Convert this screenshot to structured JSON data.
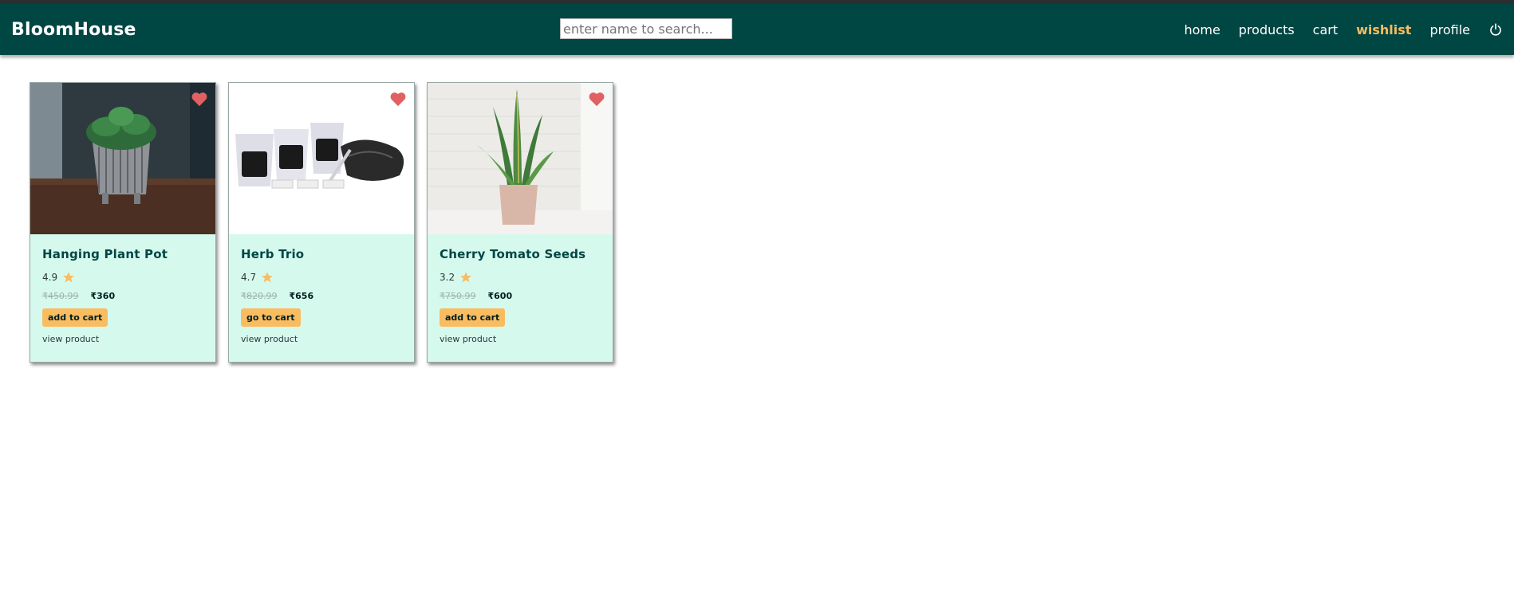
{
  "app": {
    "brand": "BloomHouse"
  },
  "search": {
    "placeholder": "enter name to search..."
  },
  "nav": {
    "links": [
      {
        "label": "home",
        "active": false
      },
      {
        "label": "products",
        "active": false
      },
      {
        "label": "cart",
        "active": false
      },
      {
        "label": "wishlist",
        "active": true
      },
      {
        "label": "profile",
        "active": false
      }
    ],
    "logout_icon": "power-icon"
  },
  "colors": {
    "navbar": "#004643",
    "accent": "#f9bc60",
    "card_bg": "#d6f9ee",
    "heart": "#e16162"
  },
  "products": [
    {
      "name": "Hanging Plant Pot",
      "rating": "4.9",
      "original_price": "₹450.99",
      "price": "₹360",
      "button_label": "add to cart",
      "link_label": "view product",
      "image": "silver-pot-plant-photo",
      "wishlisted": true
    },
    {
      "name": "Herb Trio",
      "rating": "4.7",
      "original_price": "₹820.99",
      "price": "₹656",
      "button_label": "go to cart",
      "link_label": "view product",
      "image": "herb-pots-kit-photo",
      "wishlisted": true
    },
    {
      "name": "Cherry Tomato Seeds",
      "rating": "3.2",
      "original_price": "₹750.99",
      "price": "₹600",
      "button_label": "add to cart",
      "link_label": "view product",
      "image": "snake-plant-photo",
      "wishlisted": true
    }
  ]
}
